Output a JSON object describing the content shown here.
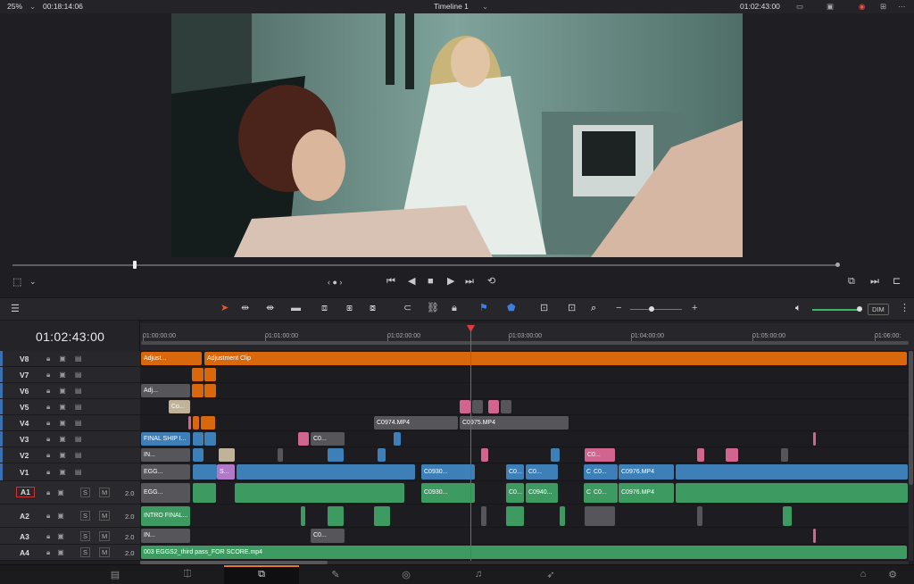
{
  "topbar": {
    "zoom": "25%",
    "source_tc": "00:18:14:06",
    "timeline_name": "Timeline 1",
    "record_tc": "01:02:43:00"
  },
  "timeline": {
    "current_tc": "01:02:43:00",
    "ruler_labels": [
      "01:00:00:00",
      "01:01:00:00",
      "01:02:00:00",
      "01:03:00:00",
      "01:04:00:00",
      "01:05:00:00",
      "01:06:00:"
    ],
    "tracks": {
      "v8": "V8",
      "v7": "V7",
      "v6": "V6",
      "v5": "V5",
      "v4": "V4",
      "v3": "V3",
      "v2": "V2",
      "v1": "V1",
      "a1": "A1",
      "a2": "A2",
      "a3": "A3",
      "a4": "A4"
    },
    "audio_vol": "2.0",
    "solo": "S",
    "mute": "M",
    "clips": {
      "adj1": "Adjust...",
      "adj2": "Adjustment Clip",
      "adj_v6": "Adj...",
      "co_v5": "Co...",
      "c0974": "C0974.MP4",
      "c0975": "C0975.MP4",
      "final_ship": "FINAL SHIP I...",
      "c0_v3": "C0...",
      "in_v2": "IN...",
      "c0_v2": "C0...",
      "eggs_v1": "EGG...",
      "s_v1": "S...",
      "c0930_v1": "C0930...",
      "c0_v1a": "C0...",
      "c0_v1b": "C0...",
      "c0_v1c": "C0...",
      "c0_v1d": "C0...",
      "c0976_v1": "C0976.MP4",
      "eggs_a1": "EGG...",
      "c0930_a1": "C0930...",
      "c0_a1": "C0...",
      "c0940_a1": "C0940...",
      "c0_a1b": "C0...",
      "c0_a1c": "C0...",
      "c0976_a1": "C0976.MP4",
      "intro_a2": "INTRO FINAL...",
      "in_a3": "IN...",
      "c0_a3": "C0...",
      "a4_clip": "003 EGGS2_third pass_FOR SCORE.mp4"
    }
  },
  "toolbar": {
    "dim_label": "DIM"
  },
  "colors": {
    "accent": "#e2793a",
    "playhead": "#e23b3b",
    "orange_clip": "#d9680d",
    "video_clip": "#3f7fb8",
    "audio_clip": "#3d9b62"
  }
}
